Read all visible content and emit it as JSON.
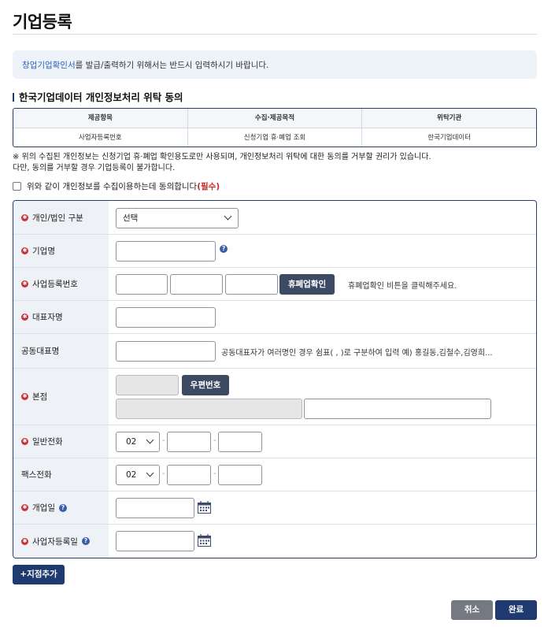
{
  "page": {
    "title": "기업등록"
  },
  "notice": {
    "link_text": "창업기업확인서",
    "rest_text": "를 발급/출력하기 위해서는 반드시 입력하시기 바랍니다."
  },
  "consent": {
    "title": "한국기업데이터 개인정보처리 위탁 동의",
    "headers": [
      "제공항목",
      "수집·제공목적",
      "위탁기관"
    ],
    "row": [
      "사업자등록번호",
      "신청기업 휴·폐업 조회",
      "한국기업데이터"
    ],
    "note_line1": "※ 위의 수집된 개인정보는 신청기업 휴·폐업 확인용도로만 사용되며, 개인정보처리 위탁에 대한 동의를 거부할 권리가 있습니다.",
    "note_line2": "다만, 동의를 거부할 경우 기업등록이 불가합니다.",
    "agree_text": "위와 같이 개인정보를 수집이용하는데 동의합니다",
    "agree_required": "(필수)",
    "agree_checked": false
  },
  "form": {
    "required_mark": "✱",
    "help_mark": "?",
    "entity_type": {
      "label": "개인/법인 구분",
      "selected": "선택"
    },
    "company_name": {
      "label": "기업명",
      "value": ""
    },
    "biz_reg_no": {
      "label": "사업등록번호",
      "part1": "",
      "part2": "",
      "part3": "",
      "button": "휴폐업확인",
      "hint": "휴폐업확인 비튼을 클릭해주세요."
    },
    "ceo_name": {
      "label": "대표자명",
      "value": ""
    },
    "co_ceo": {
      "label": "공동대표명",
      "value": "",
      "hint": "공동대표자가 여러명인 경우 쉼표( , )로 구분하여 입력    예) 홍길동,김철수,김영희..."
    },
    "hq": {
      "label": "본점",
      "postcode": "",
      "postcode_button": "우편번호",
      "address": "",
      "address_detail": ""
    },
    "phone": {
      "label": "일반전화",
      "area": "02",
      "mid": "",
      "last": "",
      "separator": "-"
    },
    "fax": {
      "label": "팩스전화",
      "area": "02",
      "mid": "",
      "last": "",
      "separator": "-"
    },
    "open_date": {
      "label": "개업일",
      "value": ""
    },
    "biz_reg_date": {
      "label": "사업자등록일",
      "value": ""
    }
  },
  "buttons": {
    "add_branch": "+지점추가",
    "cancel": "취소",
    "done": "완료"
  }
}
